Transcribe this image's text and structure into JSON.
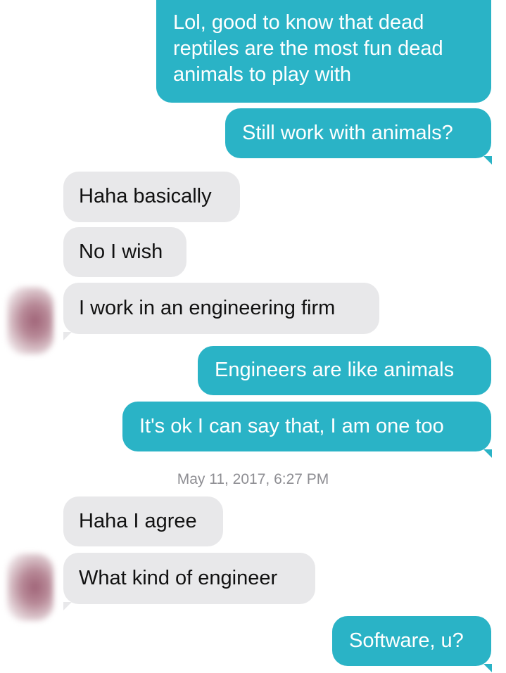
{
  "conversation": {
    "messages": [
      {
        "from": "me",
        "text_lines": [
          "Lol, good to know that dead",
          "reptiles are the most fun dead",
          "animals to play with"
        ]
      },
      {
        "from": "me",
        "text": "Still work with animals?"
      },
      {
        "from": "them",
        "text": "Haha basically"
      },
      {
        "from": "them",
        "text": "No I wish"
      },
      {
        "from": "them",
        "text": "I work in an engineering firm"
      },
      {
        "from": "me",
        "text": "Engineers are like animals"
      },
      {
        "from": "me",
        "text": "It's ok I can say that, I am one too"
      },
      {
        "from": "them",
        "text": "Haha I agree"
      },
      {
        "from": "them",
        "text": "What kind of engineer"
      },
      {
        "from": "me",
        "text": "Software, u?"
      }
    ],
    "timestamp": "May 11, 2017, 6:27 PM",
    "colors": {
      "outgoing_bubble": "#2ab3c6",
      "incoming_bubble": "#e8e8ea",
      "timestamp_text": "#8e8e93"
    }
  }
}
